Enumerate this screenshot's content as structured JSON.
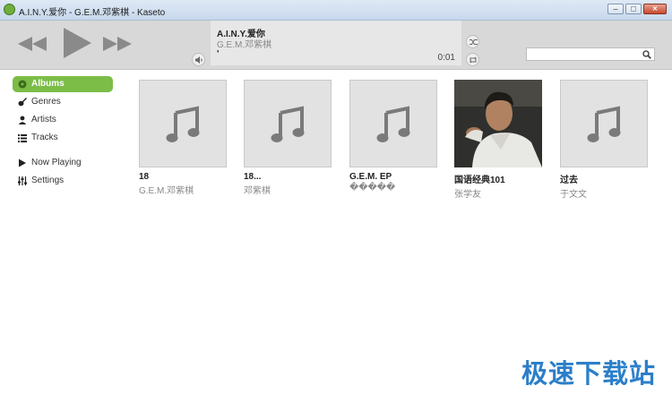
{
  "window": {
    "title": "A.I.N.Y.爱你 - G.E.M.邓紫棋 - Kaseto"
  },
  "player": {
    "track_title": "A.I.N.Y.爱你",
    "track_artist": "G.E.M.邓紫棋",
    "progress_mark": "'",
    "time": "0:01",
    "search_placeholder": "",
    "search_value": ""
  },
  "sidebar": {
    "items": [
      {
        "label": "Albums",
        "icon": "disc-icon"
      },
      {
        "label": "Genres",
        "icon": "guitar-icon"
      },
      {
        "label": "Artists",
        "icon": "person-icon"
      },
      {
        "label": "Tracks",
        "icon": "list-icon"
      },
      {
        "label": "Now Playing",
        "icon": "play-icon"
      },
      {
        "label": "Settings",
        "icon": "sliders-icon"
      }
    ],
    "active": "Albums"
  },
  "albums": [
    {
      "title": "18",
      "artist": "G.E.M.邓紫棋",
      "cover": "music-note"
    },
    {
      "title": "18...",
      "artist": "邓紫棋",
      "cover": "music-note"
    },
    {
      "title": "G.E.M. EP",
      "artist": "�����",
      "cover": "music-note"
    },
    {
      "title": "国语经典101",
      "artist": "张学友",
      "cover": "photo"
    },
    {
      "title": "过去",
      "artist": "于文文",
      "cover": "music-note"
    }
  ],
  "watermark": "极速下载站",
  "colors": {
    "accent": "#7bbd47",
    "player_bg": "#d8d8d8",
    "watermark": "#2c7fc9"
  }
}
